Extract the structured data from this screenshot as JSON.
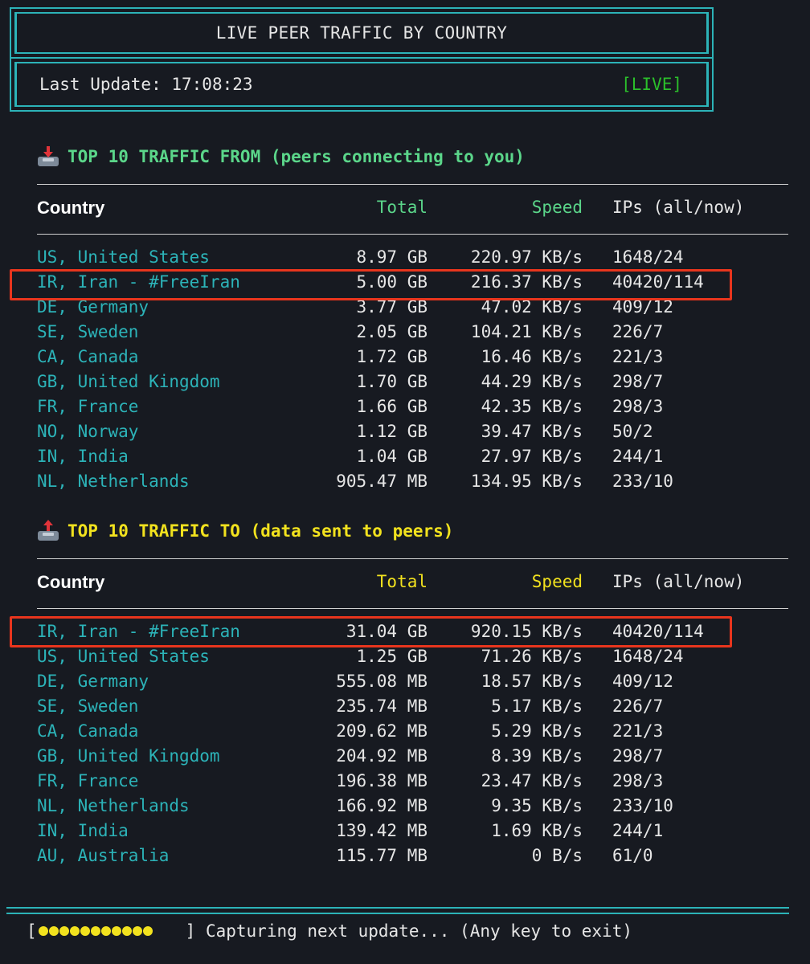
{
  "header": {
    "title": "LIVE PEER TRAFFIC BY COUNTRY",
    "last_update_label": "Last Update:",
    "last_update_time": "17:08:23",
    "live_badge": "[LIVE]"
  },
  "from_section": {
    "icon": "inbox-tray-icon",
    "heading": "TOP 10 TRAFFIC FROM (peers connecting to you)",
    "columns": [
      "Country",
      "Total",
      "Speed",
      "IPs (all/now)"
    ],
    "rows": [
      {
        "country": "US, United States",
        "total": "8.97 GB",
        "speed": "220.97 KB/s",
        "ips": "1648/24"
      },
      {
        "country": "IR, Iran - #FreeIran",
        "total": "5.00 GB",
        "speed": "216.37 KB/s",
        "ips": "40420/114"
      },
      {
        "country": "DE, Germany",
        "total": "3.77 GB",
        "speed": "47.02 KB/s",
        "ips": "409/12"
      },
      {
        "country": "SE, Sweden",
        "total": "2.05 GB",
        "speed": "104.21 KB/s",
        "ips": "226/7"
      },
      {
        "country": "CA, Canada",
        "total": "1.72 GB",
        "speed": "16.46 KB/s",
        "ips": "221/3"
      },
      {
        "country": "GB, United Kingdom",
        "total": "1.70 GB",
        "speed": "44.29 KB/s",
        "ips": "298/7"
      },
      {
        "country": "FR, France",
        "total": "1.66 GB",
        "speed": "42.35 KB/s",
        "ips": "298/3"
      },
      {
        "country": "NO, Norway",
        "total": "1.12 GB",
        "speed": "39.47 KB/s",
        "ips": "50/2"
      },
      {
        "country": "IN, India",
        "total": "1.04 GB",
        "speed": "27.97 KB/s",
        "ips": "244/1"
      },
      {
        "country": "NL, Netherlands",
        "total": "905.47 MB",
        "speed": "134.95 KB/s",
        "ips": "233/10"
      }
    ]
  },
  "to_section": {
    "icon": "outbox-tray-icon",
    "heading": "TOP 10 TRAFFIC TO (data sent to peers)",
    "columns": [
      "Country",
      "Total",
      "Speed",
      "IPs (all/now)"
    ],
    "rows": [
      {
        "country": "IR, Iran - #FreeIran",
        "total": "31.04 GB",
        "speed": "920.15 KB/s",
        "ips": "40420/114"
      },
      {
        "country": "US, United States",
        "total": "1.25 GB",
        "speed": "71.26 KB/s",
        "ips": "1648/24"
      },
      {
        "country": "DE, Germany",
        "total": "555.08 MB",
        "speed": "18.57 KB/s",
        "ips": "409/12"
      },
      {
        "country": "SE, Sweden",
        "total": "235.74 MB",
        "speed": "5.17 KB/s",
        "ips": "226/7"
      },
      {
        "country": "CA, Canada",
        "total": "209.62 MB",
        "speed": "5.29 KB/s",
        "ips": "221/3"
      },
      {
        "country": "GB, United Kingdom",
        "total": "204.92 MB",
        "speed": "8.39 KB/s",
        "ips": "298/7"
      },
      {
        "country": "FR, France",
        "total": "196.38 MB",
        "speed": "23.47 KB/s",
        "ips": "298/3"
      },
      {
        "country": "NL, Netherlands",
        "total": "166.92 MB",
        "speed": "9.35 KB/s",
        "ips": "233/10"
      },
      {
        "country": "IN, India",
        "total": "139.42 MB",
        "speed": "1.69 KB/s",
        "ips": "244/1"
      },
      {
        "country": "AU, Australia",
        "total": "115.77 MB",
        "speed": "0 B/s",
        "ips": "61/0"
      }
    ]
  },
  "footer": {
    "bracket_open": "[",
    "bracket_close": "]",
    "progress_filled": 11,
    "progress_total": 14,
    "status_text": "Capturing next update... (Any key to exit)"
  },
  "colors": {
    "background": "#171a21",
    "frame": "#2cb3b8",
    "from_accent": "#5bd68a",
    "to_accent": "#f2e21e",
    "live": "#2bbf2b",
    "highlight": "#e8351d"
  }
}
